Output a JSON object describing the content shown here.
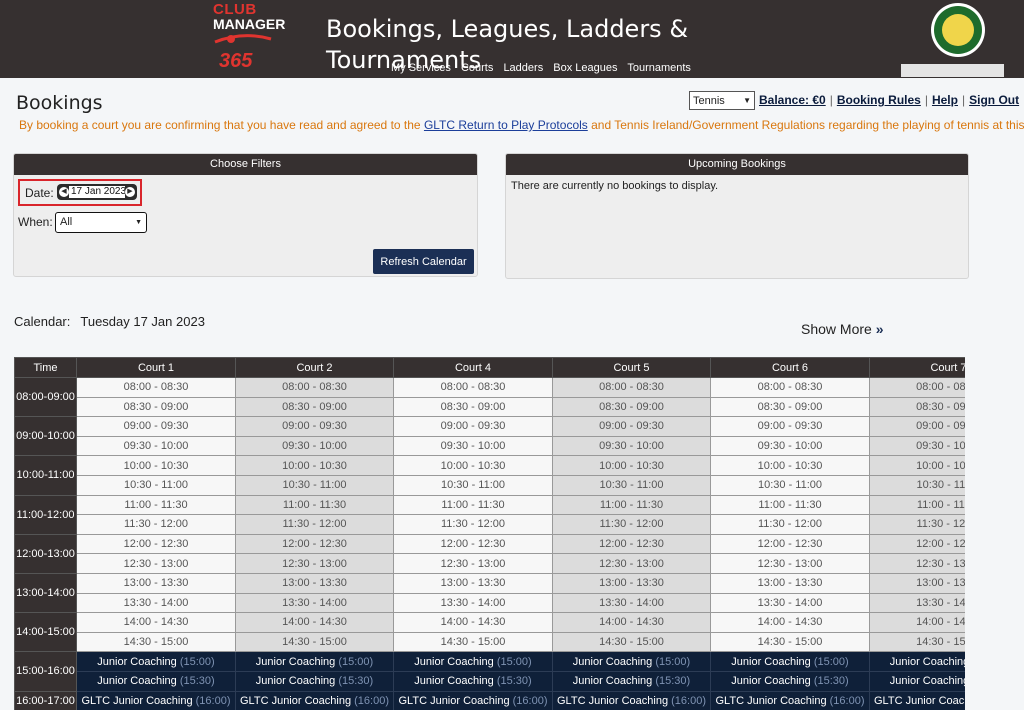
{
  "header": {
    "logo_line1": "CLUB",
    "logo_line2": "MANAGER",
    "logo_line3": "365",
    "title": "Bookings, Leagues, Ladders & Tournaments",
    "nav": [
      "My Services",
      "Courts",
      "Ladders",
      "Box Leagues",
      "Tournaments"
    ]
  },
  "page": {
    "title": "Bookings",
    "sport_select": "Tennis",
    "links": {
      "balance": "Balance: €0",
      "booking_rules": "Booking Rules",
      "help": "Help",
      "sign_out": "Sign Out"
    },
    "notice_prefix": "By booking a court you are confirming that you have read and agreed to the ",
    "notice_link": "GLTC Return to Play Protocols",
    "notice_suffix": " and Tennis Ireland/Government Regulations regarding the playing of tennis at this time"
  },
  "filters": {
    "heading": "Choose Filters",
    "date_label": "Date:",
    "date_value": "17 Jan 2023",
    "when_label": "When:",
    "when_value": "All",
    "refresh_label": "Refresh Calendar"
  },
  "upcoming": {
    "heading": "Upcoming Bookings",
    "empty_text": "There are currently no bookings to display."
  },
  "calendar": {
    "label": "Calendar:",
    "date": "Tuesday 17 Jan 2023",
    "show_more": "Show More",
    "columns": [
      "Time",
      "Court 1",
      "Court 2",
      "Court 4",
      "Court 5",
      "Court 6",
      "Court 7"
    ],
    "hours": [
      "08:00-09:00",
      "09:00-10:00",
      "10:00-11:00",
      "11:00-12:00",
      "12:00-13:00",
      "13:00-14:00",
      "14:00-15:00",
      "15:00-16:00",
      "16:00-17:00"
    ],
    "slots": [
      "08:00 - 08:30",
      "08:30 - 09:00",
      "09:00 - 09:30",
      "09:30 - 10:00",
      "10:00 - 10:30",
      "10:30 - 11:00",
      "11:00 - 11:30",
      "11:30 - 12:00",
      "12:00 - 12:30",
      "12:30 - 13:00",
      "13:00 - 13:30",
      "13:30 - 14:00",
      "14:00 - 14:30",
      "14:30 - 15:00"
    ],
    "bookings": [
      {
        "name": "Junior Coaching",
        "time": "(15:00)"
      },
      {
        "name": "Junior Coaching",
        "time": "(15:30)"
      },
      {
        "name": "GLTC Junior Coaching",
        "time": "(16:00)"
      }
    ]
  }
}
